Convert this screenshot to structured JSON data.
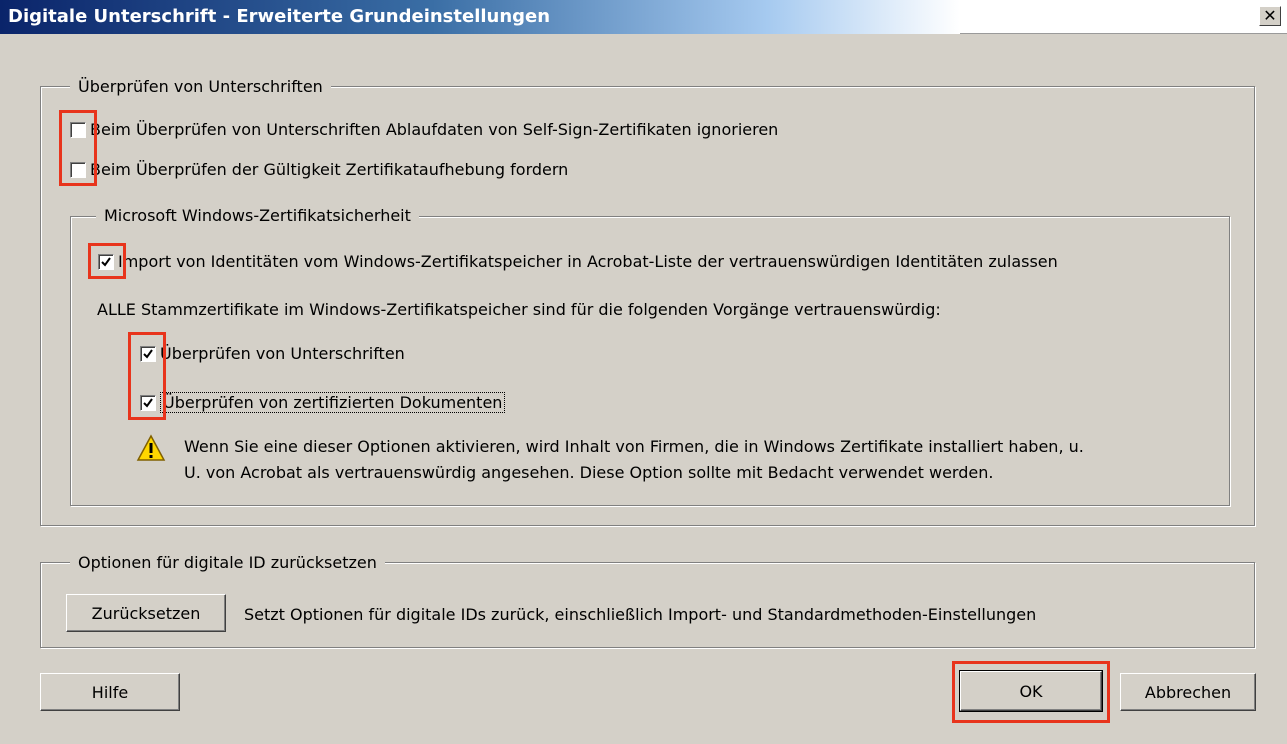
{
  "window": {
    "title": "Digitale Unterschrift - Erweiterte Grundeinstellungen",
    "close_glyph": "✕"
  },
  "verify_group": {
    "legend": "Überprüfen von Unterschriften",
    "options": [
      {
        "label": "Beim Überprüfen von Unterschriften Ablaufdaten von Self-Sign-Zertifikaten ignorieren",
        "checked": false
      },
      {
        "label": "Beim Überprüfen der Gültigkeit Zertifikataufhebung fordern",
        "checked": false
      }
    ]
  },
  "windows_group": {
    "legend": "Microsoft Windows-Zertifikatsicherheit",
    "import_option": {
      "label": "Import von Identitäten vom Windows-Zertifikatspeicher in Acrobat-Liste der vertrauenswürdigen Identitäten zulassen",
      "checked": true
    },
    "trust_caption": "ALLE Stammzertifikate im Windows-Zertifikatspeicher sind für die folgenden Vorgänge vertrauenswürdig:",
    "trust_options": [
      {
        "label": "Überprüfen von Unterschriften",
        "checked": true
      },
      {
        "label": "Überprüfen von zertifizierten Dokumenten",
        "checked": true
      }
    ],
    "warning_line1": "Wenn Sie eine dieser Optionen aktivieren, wird Inhalt von Firmen, die in Windows Zertifikate installiert haben, u.",
    "warning_line2": "U. von Acrobat als vertrauenswürdig angesehen. Diese Option sollte mit Bedacht verwendet werden."
  },
  "reset_group": {
    "legend": "Optionen für digitale ID zurücksetzen",
    "button_label": "Zurücksetzen",
    "description": "Setzt Optionen für digitale IDs zurück, einschließlich Import- und Standardmethoden-Einstellungen"
  },
  "buttons": {
    "help": "Hilfe",
    "ok": "OK",
    "cancel": "Abbrechen"
  },
  "colors": {
    "highlight": "#e8341c",
    "dialog_bg": "#d4d0c8",
    "title_bar": "#0a246a"
  }
}
